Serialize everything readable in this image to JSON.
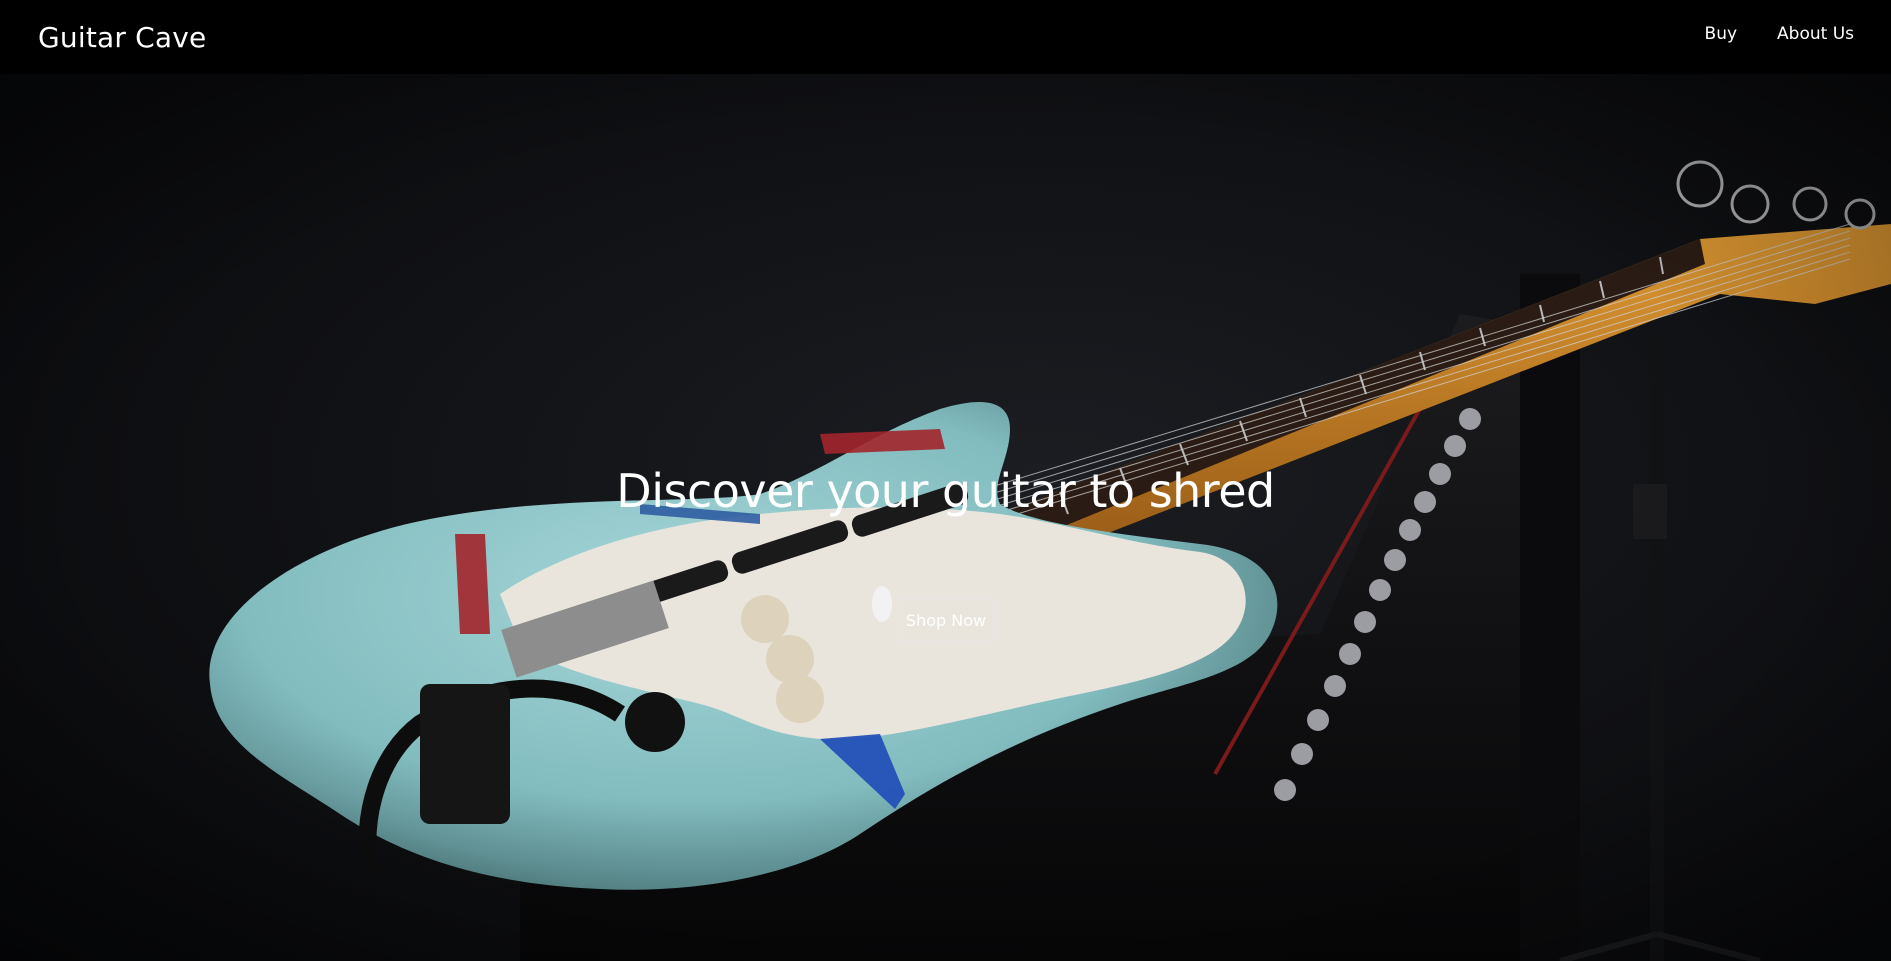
{
  "nav": {
    "brand": "Guitar Cave",
    "links": [
      {
        "label": "Buy"
      },
      {
        "label": "About Us"
      }
    ]
  },
  "hero": {
    "title": "Discover your guitar to shred",
    "cta_label": "Shop Now",
    "image_subject": "electric-guitar-on-amplifier"
  },
  "colors": {
    "navbar_bg": "#000000",
    "text": "#ffffff",
    "guitar_body": "#8fc5c7",
    "neck": "#c9862a",
    "fretboard": "#2a1c14"
  }
}
